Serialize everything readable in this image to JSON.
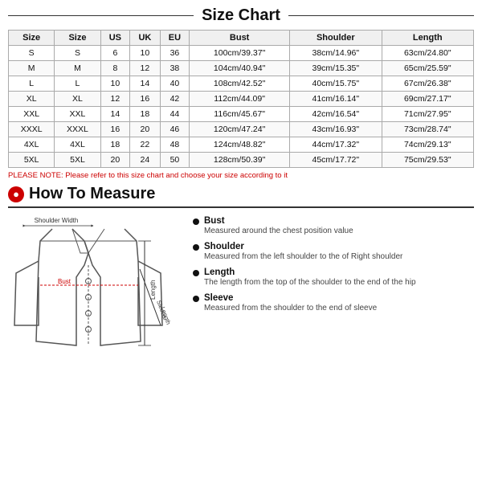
{
  "title": "Size Chart",
  "table": {
    "headers": [
      "Size",
      "Size",
      "US",
      "UK",
      "EU",
      "Bust",
      "Shoulder",
      "Length"
    ],
    "rows": [
      [
        "S",
        "S",
        "6",
        "10",
        "36",
        "100cm/39.37\"",
        "38cm/14.96\"",
        "63cm/24.80\""
      ],
      [
        "M",
        "M",
        "8",
        "12",
        "38",
        "104cm/40.94\"",
        "39cm/15.35\"",
        "65cm/25.59\""
      ],
      [
        "L",
        "L",
        "10",
        "14",
        "40",
        "108cm/42.52\"",
        "40cm/15.75\"",
        "67cm/26.38\""
      ],
      [
        "XL",
        "XL",
        "12",
        "16",
        "42",
        "112cm/44.09\"",
        "41cm/16.14\"",
        "69cm/27.17\""
      ],
      [
        "XXL",
        "XXL",
        "14",
        "18",
        "44",
        "116cm/45.67\"",
        "42cm/16.54\"",
        "71cm/27.95\""
      ],
      [
        "XXXL",
        "XXXL",
        "16",
        "20",
        "46",
        "120cm/47.24\"",
        "43cm/16.93\"",
        "73cm/28.74\""
      ],
      [
        "4XL",
        "4XL",
        "18",
        "22",
        "48",
        "124cm/48.82\"",
        "44cm/17.32\"",
        "74cm/29.13\""
      ],
      [
        "5XL",
        "5XL",
        "20",
        "24",
        "50",
        "128cm/50.39\"",
        "45cm/17.72\"",
        "75cm/29.53\""
      ]
    ]
  },
  "note": "PLEASE NOTE: Please refer to this size chart and choose your size according to it",
  "how_to_measure": {
    "title": "How To Measure",
    "items": [
      {
        "title": "Bust",
        "desc": "Measured around the chest position value"
      },
      {
        "title": "Shoulder",
        "desc": "Measured from the left shoulder to the of Right shoulder"
      },
      {
        "title": "Length",
        "desc": "The length from the top of the shoulder to the end of the hip"
      },
      {
        "title": "Sleeve",
        "desc": "Measured from the shoulder to the end of sleeve"
      }
    ]
  },
  "jacket_labels": {
    "shoulder_width": "Shoulder Width",
    "bust": "Bust",
    "sleeve_length": "Sleeve\nLength",
    "length": "Length"
  }
}
